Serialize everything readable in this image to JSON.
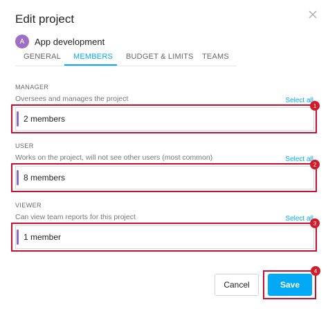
{
  "dialog": {
    "title": "Edit project",
    "close_icon": "close-icon"
  },
  "project": {
    "avatar_letter": "A",
    "avatar_color": "#9c6fc4",
    "name": "App development"
  },
  "tabs": [
    {
      "label": "GENERAL",
      "active": false
    },
    {
      "label": "MEMBERS",
      "active": true
    },
    {
      "label": "BUDGET & LIMITS",
      "active": false
    },
    {
      "label": "TEAMS",
      "active": false
    }
  ],
  "sections": [
    {
      "label": "MANAGER",
      "description": "Oversees and manages the project",
      "select_all": "Select all",
      "value": "2 members",
      "marker": "1"
    },
    {
      "label": "USER",
      "description": "Works on the project, will not see other users (most common)",
      "select_all": "Select all",
      "value": "8 members",
      "marker": "2"
    },
    {
      "label": "VIEWER",
      "description": "Can view team reports for this project",
      "select_all": "Select all",
      "value": "1 member",
      "marker": "3"
    }
  ],
  "footer": {
    "cancel_label": "Cancel",
    "save_label": "Save",
    "save_marker": "4"
  },
  "colors": {
    "accent": "#03a9f4",
    "highlight": "#c8102e",
    "role_bar": "#8a6ad0"
  }
}
